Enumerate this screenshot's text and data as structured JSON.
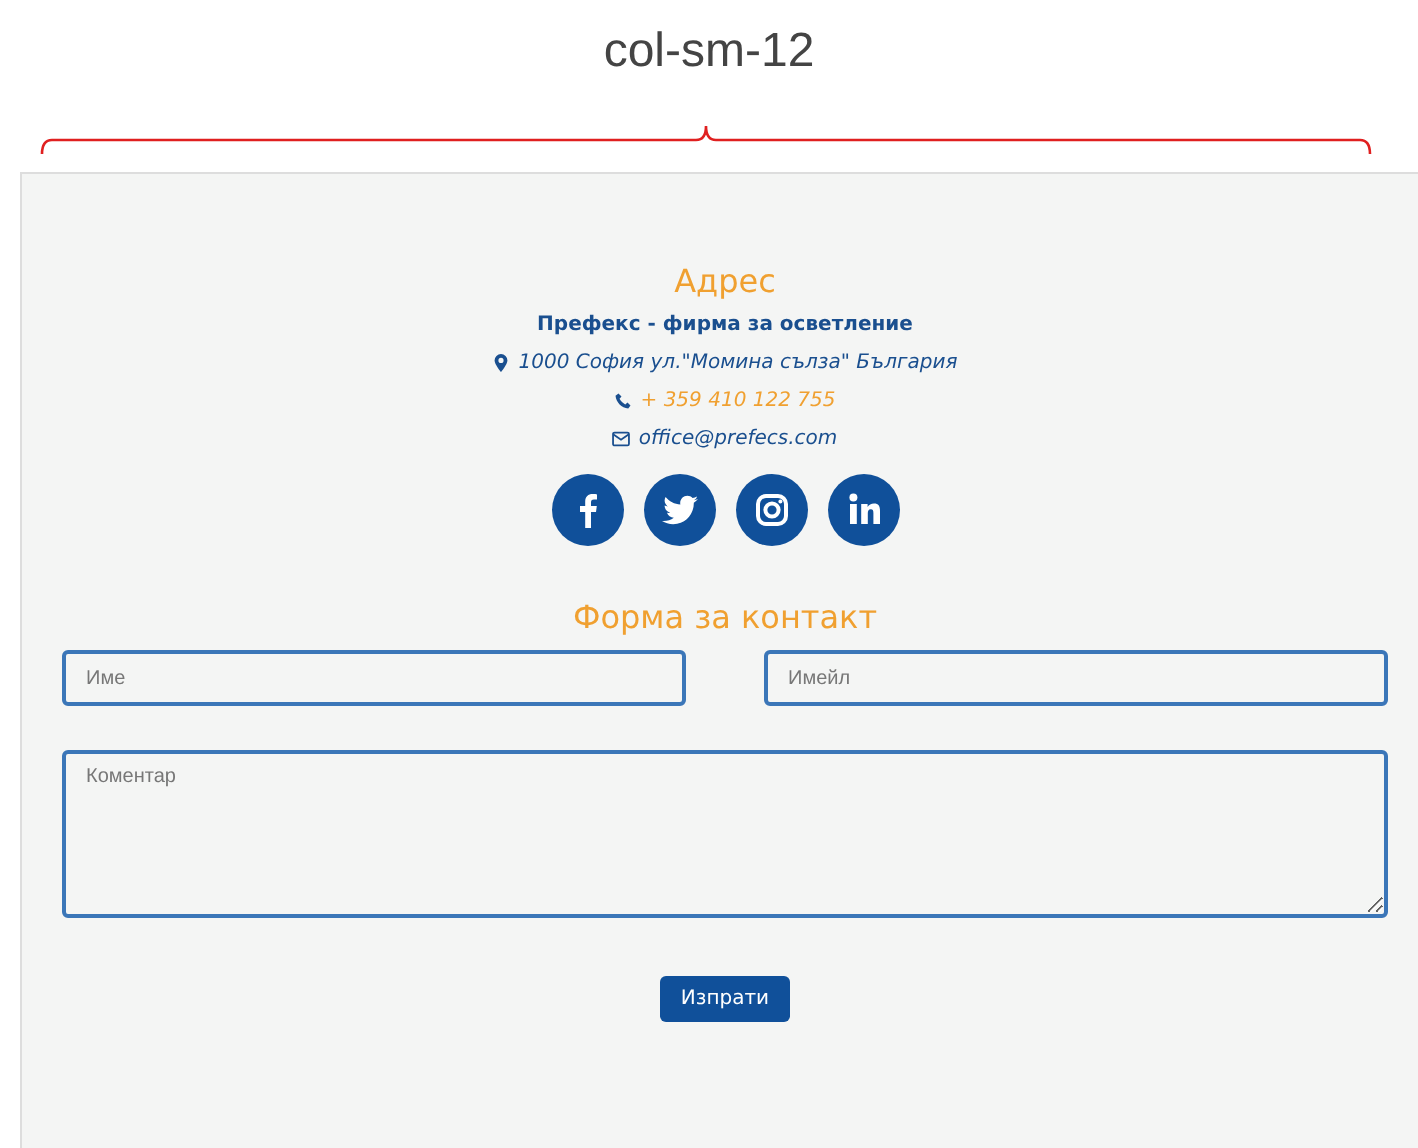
{
  "annotation": {
    "label": "col-sm-12"
  },
  "address": {
    "heading": "Адрес",
    "company": "Префекс - фирма за осветление",
    "street": "1000 София ул.\"Момина сълза\" България",
    "phone": "+ 359 410 122 755",
    "email": "office@prefecs.com"
  },
  "social": [
    {
      "kind": "facebook"
    },
    {
      "kind": "twitter"
    },
    {
      "kind": "instagram"
    },
    {
      "kind": "linkedin"
    }
  ],
  "form": {
    "heading": "Форма за контакт",
    "name": {
      "placeholder": "Име"
    },
    "email": {
      "placeholder": "Имейл"
    },
    "comment": {
      "placeholder": "Коментар"
    },
    "submit": "Изпрати"
  }
}
